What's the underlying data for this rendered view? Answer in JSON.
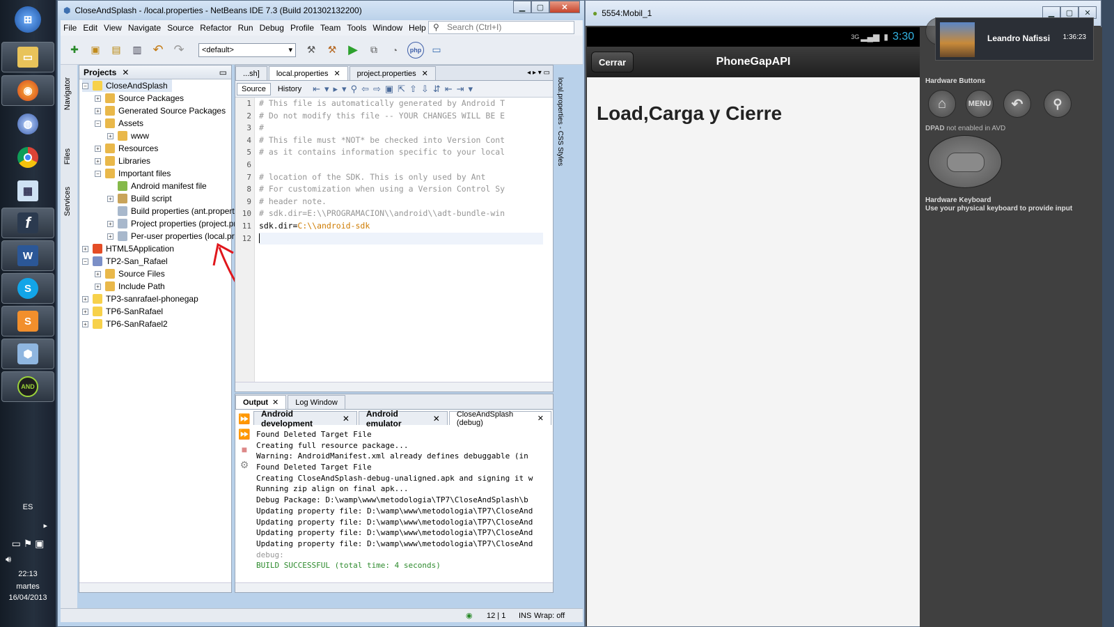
{
  "taskbar": {
    "apps": [
      "windows-start",
      "file-explorer",
      "firefox",
      "firefox-nightly",
      "chrome",
      "calculator",
      "flash",
      "word",
      "skype",
      "sublime",
      "virtualbox",
      "android-sdk"
    ],
    "language": "ES",
    "time": "22:13",
    "day": "martes",
    "date": "16/04/2013"
  },
  "netbeans": {
    "title": "CloseAndSplash - /local.properties - NetBeans IDE 7.3 (Build 201302132200)",
    "menu": [
      "File",
      "Edit",
      "View",
      "Navigate",
      "Source",
      "Refactor",
      "Run",
      "Debug",
      "Profile",
      "Team",
      "Tools",
      "Window",
      "Help"
    ],
    "search_placeholder": "Search (Ctrl+I)",
    "config": "<default>",
    "side_tabs": [
      "Navigator",
      "Files",
      "Services"
    ],
    "projects_title": "Projects",
    "tree": [
      "CloseAndSplash",
      "Source Packages",
      "Generated Source Packages",
      "Assets",
      "www",
      "Resources",
      "Libraries",
      "Important files",
      "Android manifest file",
      "Build script",
      "Build properties (ant.properties)",
      "Project properties (project.properties)",
      "Per-user properties (local.properties)",
      "HTML5Application",
      "TP2-San_Rafael",
      "Source Files",
      "Include Path",
      "TP3-sanrafael-phonegap",
      "TP6-SanRafael",
      "TP6-SanRafael2"
    ],
    "editor_tabs": [
      "...sh]",
      "local.properties",
      "project.properties"
    ],
    "source_btn": "Source",
    "history_btn": "History",
    "right_strip": "local.properties - CSS Styles",
    "line_numbers": [
      "1",
      "2",
      "3",
      "4",
      "5",
      "6",
      "7",
      "8",
      "9",
      "10",
      "11",
      "12"
    ],
    "code": [
      "# This file is automatically generated by Android T",
      "# Do not modify this file -- YOUR CHANGES WILL BE E",
      "#",
      "# This file must *NOT* be checked into Version Cont",
      "# as it contains information specific to your local",
      "",
      "# location of the SDK. This is only used by Ant",
      "# For customization when using a Version Control Sy",
      "# header note.",
      "# sdk.dir=E:\\\\PROGRAMACION\\\\android\\\\adt-bundle-win"
    ],
    "code_key": "sdk.dir=",
    "code_value": "C:\\\\android-sdk",
    "output_tabs": [
      "Output",
      "Log Window"
    ],
    "output_subtabs": [
      "Android development",
      "Android emulator",
      "CloseAndSplash (debug)"
    ],
    "output_lines": [
      "Found Deleted Target File",
      "Creating full resource package...",
      "Warning: AndroidManifest.xml already defines debuggable (in",
      "Found Deleted Target File",
      "Creating CloseAndSplash-debug-unaligned.apk and signing it w",
      "Running zip align on final apk...",
      "Debug Package: D:\\wamp\\www\\metodologia\\TP7\\CloseAndSplash\\b",
      "Updating property file: D:\\wamp\\www\\metodologia\\TP7\\CloseAnd",
      "Updating property file: D:\\wamp\\www\\metodologia\\TP7\\CloseAnd",
      "Updating property file: D:\\wamp\\www\\metodologia\\TP7\\CloseAnd",
      "Updating property file: D:\\wamp\\www\\metodologia\\TP7\\CloseAnd"
    ],
    "output_debug": "debug:",
    "output_success": "BUILD SUCCESSFUL (total time: 4 seconds)",
    "status_pos": "12 | 1",
    "status_ins": "INS",
    "status_wrap": "Wrap: off"
  },
  "emulator": {
    "title": "5554:Mobil_1",
    "network": "3G",
    "clock": "3:30",
    "button": "Cerrar",
    "app_title": "PhoneGapAPI",
    "heading": "Load,Carga y Cierre",
    "hw_buttons_label": "Hardware Buttons",
    "menu_label": "MENU",
    "dpad_note_bold": "DPAD",
    "dpad_note": "not enabled in AVD",
    "keyboard_title": "Hardware Keyboard",
    "keyboard_note": "Use your physical keyboard to provide input"
  },
  "notification": {
    "name": "Leandro Nafissi",
    "time": "1:36:23"
  },
  "colors": {
    "accent": "#33b5e5",
    "success": "#2e8b2e",
    "comment": "#969696",
    "value": "#ce7b00",
    "arrow": "#e0171c"
  }
}
